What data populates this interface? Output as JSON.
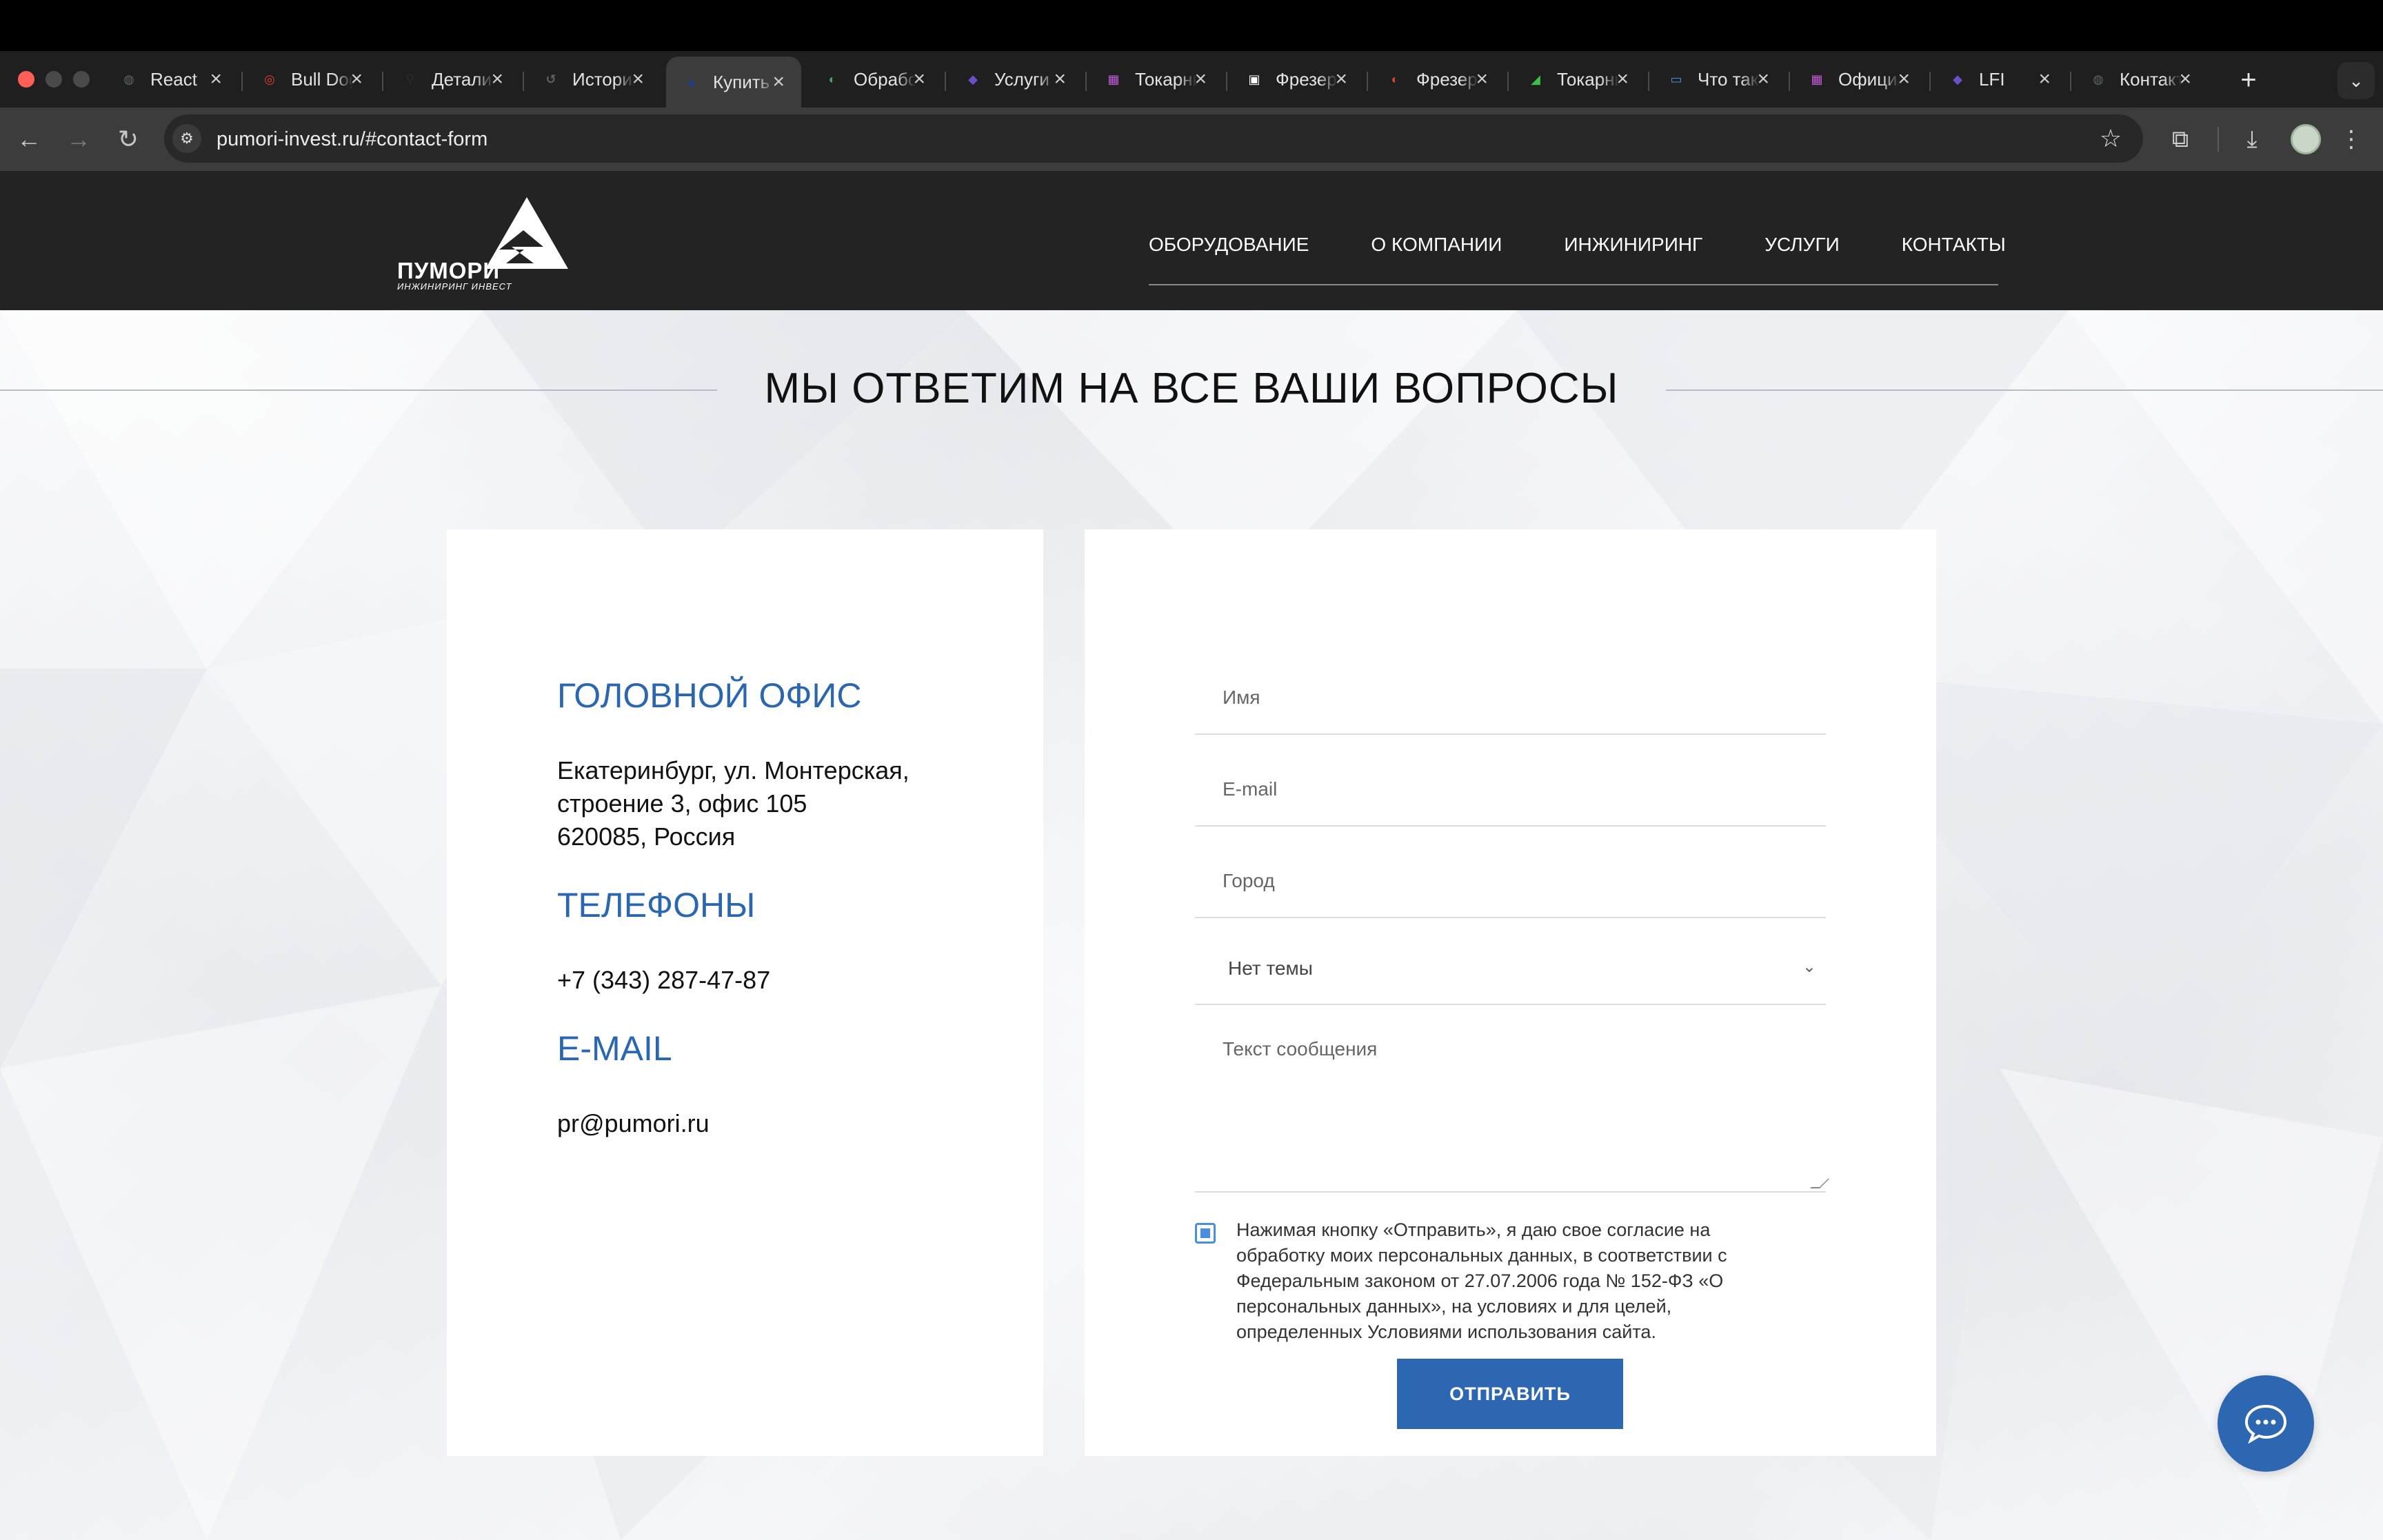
{
  "browser": {
    "tabs": [
      {
        "label": "React",
        "favicon": "globe-icon",
        "color": "#5f6368"
      },
      {
        "label": "Bull Dog",
        "favicon": "target-icon",
        "color": "#e33a3a"
      },
      {
        "label": "Детали",
        "favicon": "figure-icon",
        "color": "#2b2b2b"
      },
      {
        "label": "История",
        "favicon": "history-icon",
        "color": "#5f6368"
      },
      {
        "label": "Купить",
        "favicon": "brand-icon",
        "color": "#1b3f8b"
      },
      {
        "label": "Обработка",
        "favicon": "swirl-icon",
        "color": "#4aa36b"
      },
      {
        "label": "Услуги",
        "favicon": "cube-icon",
        "color": "#6a4fc8"
      },
      {
        "label": "Токарный",
        "favicon": "grid-icon",
        "color": "#c25ad8"
      },
      {
        "label": "Фрезерный",
        "favicon": "cnc-icon",
        "color": "#ffffff"
      },
      {
        "label": "Фрезерный",
        "favicon": "swirl-icon",
        "color": "#d9442b"
      },
      {
        "label": "Токарный",
        "favicon": "leaf-icon",
        "color": "#3fbf4a"
      },
      {
        "label": "Что такое",
        "favicon": "image-icon",
        "color": "#4a8ee0"
      },
      {
        "label": "Официальный",
        "favicon": "grid-icon",
        "color": "#c25ad8"
      },
      {
        "label": "LFI",
        "favicon": "cube-icon",
        "color": "#6a4fc8"
      },
      {
        "label": "Контакты",
        "favicon": "globe-icon",
        "color": "#5f6368"
      }
    ],
    "active_tab_index": 4,
    "url": "pumori-invest.ru/#contact-form"
  },
  "header": {
    "logo_word": "ПУМОРИ",
    "logo_sub": "ИНЖИНИРИНГ ИНВЕСТ",
    "nav": [
      "ОБОРУДОВАНИЕ",
      "О КОМПАНИИ",
      "ИНЖИНИРИНГ",
      "УСЛУГИ",
      "КОНТАКТЫ"
    ]
  },
  "section": {
    "title": "МЫ ОТВЕТИМ НА ВСЕ ВАШИ ВОПРОСЫ"
  },
  "contacts": {
    "office_heading": "ГОЛОВНОЙ ОФИС",
    "address_line1": "Екатеринбург, ул. Монтерская,",
    "address_line2": "строение 3, офис 105",
    "address_line3": "620085, Россия",
    "phones_heading": "ТЕЛЕФОНЫ",
    "phone": "+7 (343) 287-47-87",
    "email_heading": "E-MAIL",
    "email": "pr@pumori.ru"
  },
  "form": {
    "name_placeholder": "Имя",
    "email_placeholder": "E-mail",
    "city_placeholder": "Город",
    "topic_selected": "Нет темы",
    "message_placeholder": "Текст сообщения",
    "consent_checked": true,
    "consent_text": "Нажимая кнопку «Отправить», я даю свое согласие на обработку моих персональных данных, в соответствии с Федеральным законом от 27.07.2006 года № 152-ФЗ «О персональных данных», на условиях и для целей, определенных Условиями использования сайта.",
    "submit_label": "ОТПРАВИТЬ"
  },
  "colors": {
    "accent": "#2d67b2",
    "heading_blue": "#2a67b0",
    "header_bg": "#232323"
  }
}
